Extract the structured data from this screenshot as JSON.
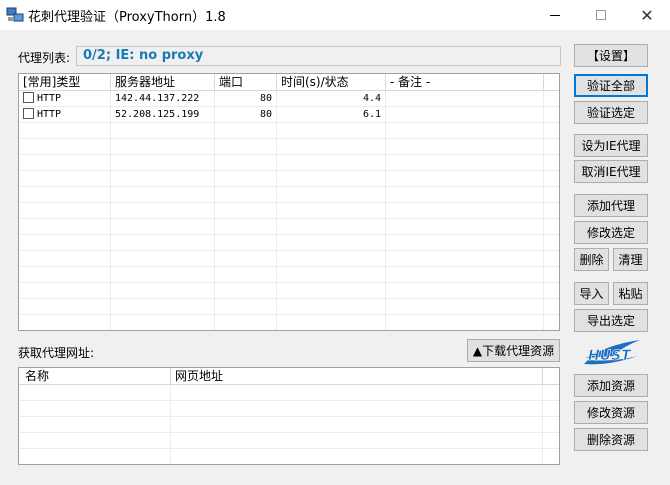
{
  "window": {
    "title": "花刺代理验证（ProxyThorn）1.8",
    "close_symbol": "✕"
  },
  "proxy_list": {
    "label": "代理列表:",
    "status": "0/2;   IE: no proxy",
    "columns": [
      "[常用]类型",
      "服务器地址",
      "端口",
      "时间(s)/状态",
      "- 备注 -"
    ],
    "rows": [
      {
        "type": "HTTP",
        "server": "142.44.137.222",
        "port": "80",
        "time": "4.4",
        "note": ""
      },
      {
        "type": "HTTP",
        "server": "52.208.125.199",
        "port": "80",
        "time": "6.1",
        "note": ""
      }
    ]
  },
  "source_list": {
    "label": "获取代理网址:",
    "download_button": "▲下载代理资源",
    "columns": [
      "名称",
      "网页地址"
    ]
  },
  "buttons": {
    "settings": "【设置】",
    "verify_all": "验证全部",
    "verify_selected": "验证选定",
    "set_ie_proxy": "设为IE代理",
    "cancel_ie_proxy": "取消IE代理",
    "add_proxy": "添加代理",
    "edit_selected": "修改选定",
    "delete": "删除",
    "clear": "清理",
    "import": "导入",
    "paste": "粘贴",
    "export_selected": "导出选定",
    "add_source": "添加资源",
    "edit_source": "修改资源",
    "delete_source": "删除资源"
  },
  "colors": {
    "status_text": "#1a7ab5",
    "logo_blue": "#1d6fc2"
  }
}
